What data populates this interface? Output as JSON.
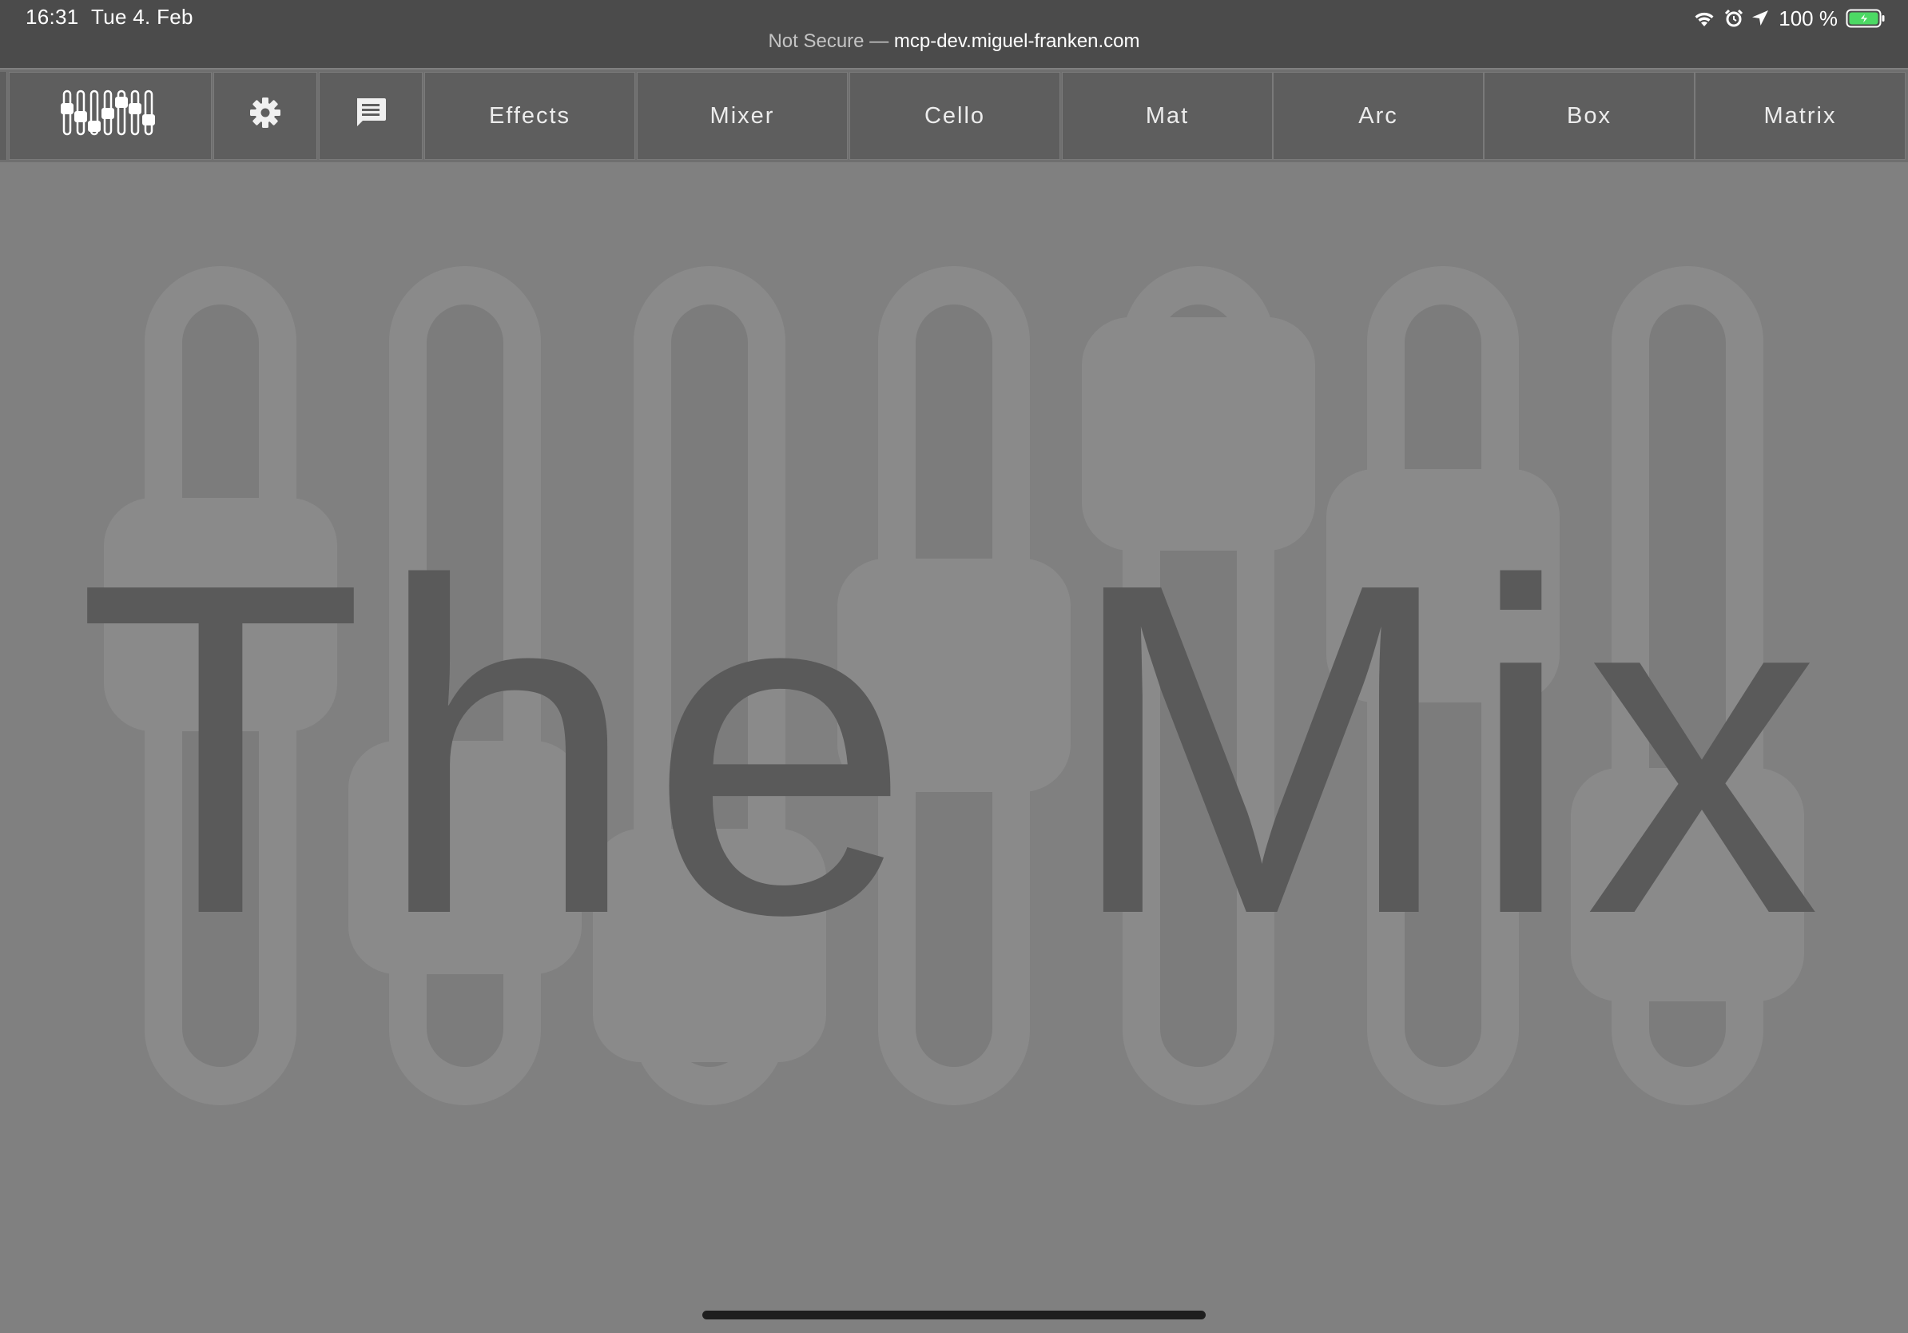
{
  "status_bar": {
    "time": "16:31",
    "date": "Tue 4. Feb",
    "security_label": "Not Secure",
    "separator": "—",
    "host": "mcp-dev.miguel-franken.com",
    "battery_percent": "100 %",
    "icons": [
      "wifi-icon",
      "alarm-icon",
      "location-icon",
      "battery-charging-icon"
    ],
    "battery_color": "#4cd964"
  },
  "toolbar": {
    "logo_icon": "mixer-faders-icon",
    "settings_icon": "gear-icon",
    "chat_icon": "message-icon",
    "tabs": [
      "Effects",
      "Mixer",
      "Cello",
      "Mat",
      "Arc",
      "Box",
      "Matrix"
    ]
  },
  "main": {
    "title": "The Mix",
    "background_art": "fader-slots"
  },
  "colors": {
    "status_bar": "#4b4b4b",
    "toolbar_button": "#5e5e5e",
    "stage": "#808080",
    "fader_art": "#8a8a8a",
    "title_text": "#5a5a5a"
  }
}
